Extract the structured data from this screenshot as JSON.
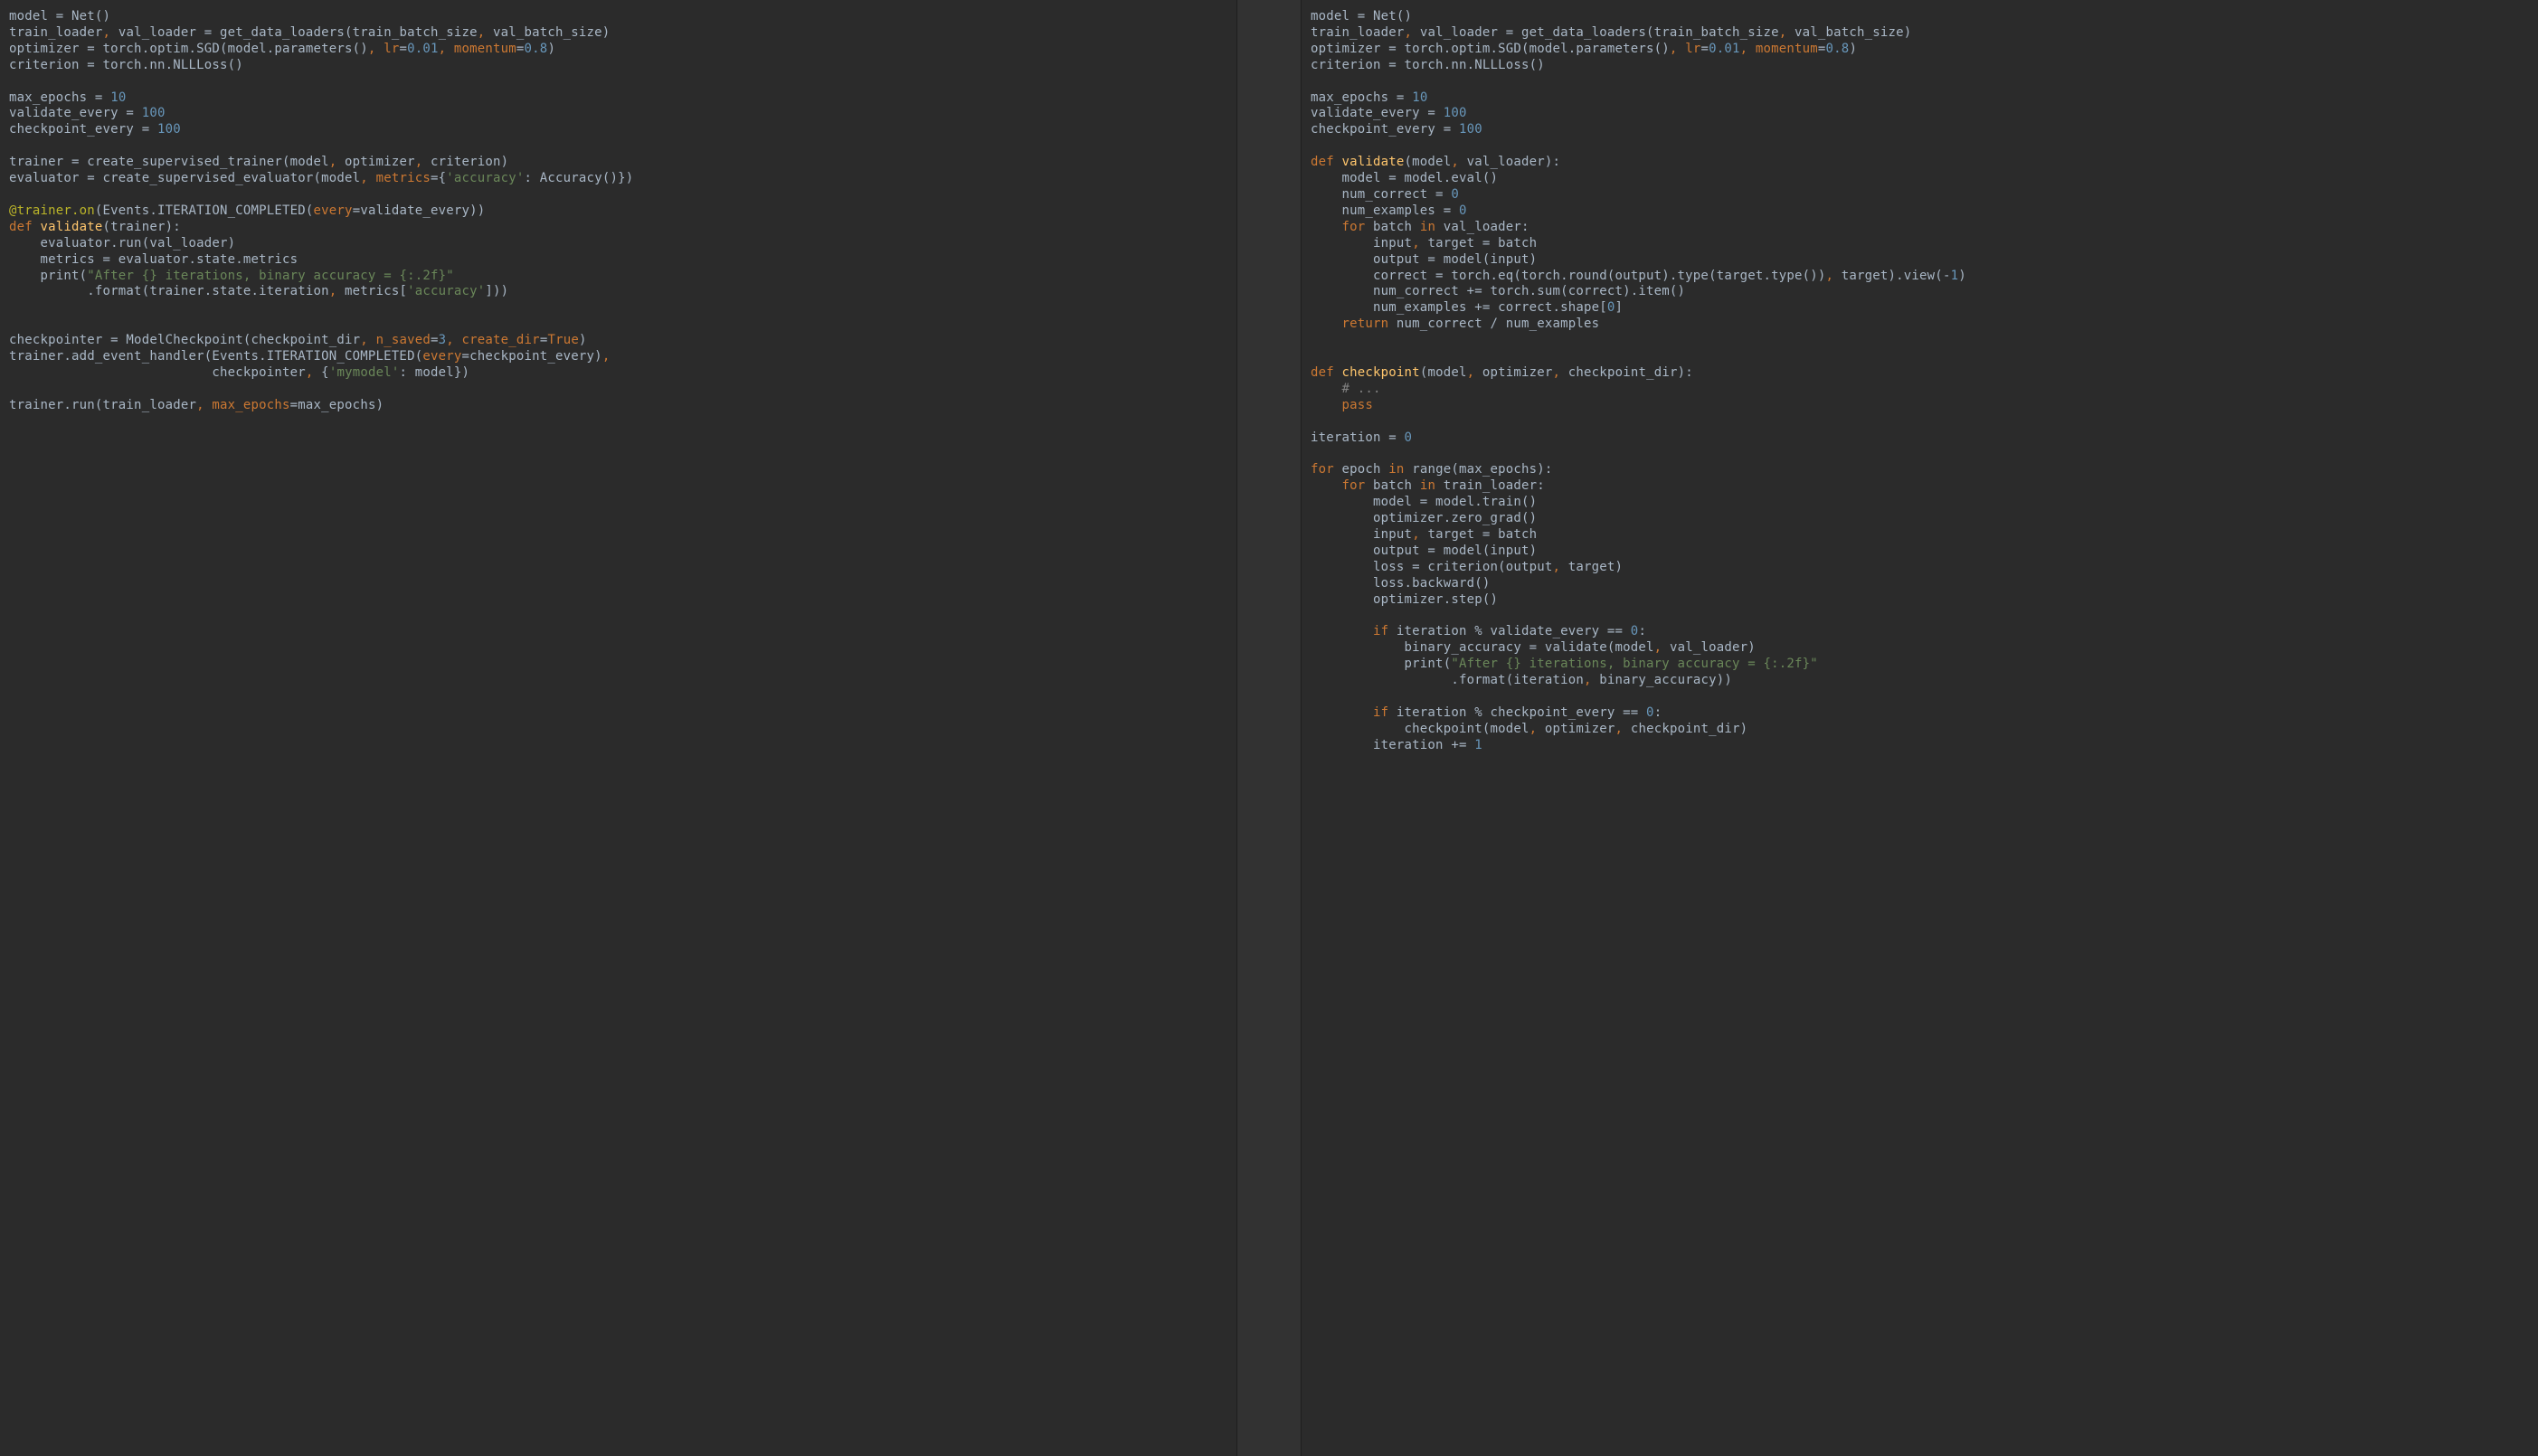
{
  "left": {
    "l1_a": "model = Net()",
    "l2_a": "train_loader",
    "l2_b": ", ",
    "l2_c": "val_loader = get_data_loaders(train_batch_size",
    "l2_d": ", ",
    "l2_e": "val_batch_size)",
    "l3_a": "optimizer = torch.optim.SGD(model.parameters()",
    "l3_b": ", ",
    "l3_c": "lr",
    "l3_d": "=",
    "l3_e": "0.01",
    "l3_f": ", ",
    "l3_g": "momentum",
    "l3_h": "=",
    "l3_i": "0.8",
    "l3_j": ")",
    "l4_a": "criterion = torch.nn.NLLLoss()",
    "l6_a": "max_epochs = ",
    "l6_b": "10",
    "l7_a": "validate_every = ",
    "l7_b": "100",
    "l8_a": "checkpoint_every = ",
    "l8_b": "100",
    "l10_a": "trainer = create_supervised_trainer(model",
    "l10_b": ", ",
    "l10_c": "optimizer",
    "l10_d": ", ",
    "l10_e": "criterion)",
    "l11_a": "evaluator = create_supervised_evaluator(model",
    "l11_b": ", ",
    "l11_c": "metrics",
    "l11_d": "={",
    "l11_e": "'accuracy'",
    "l11_f": ": Accuracy()})",
    "l13_a": "@trainer.on",
    "l13_b": "(Events.ITERATION_COMPLETED(",
    "l13_c": "every",
    "l13_d": "=validate_every))",
    "l14_a": "def ",
    "l14_b": "validate",
    "l14_c": "(trainer):",
    "l15_a": "    evaluator.run(val_loader)",
    "l16_a": "    metrics = evaluator.state.metrics",
    "l17_a": "    print(",
    "l17_b": "\"After {} iterations, binary accuracy = {:.2f}\"",
    "l18_a": "          .format(trainer.state.iteration",
    "l18_b": ", ",
    "l18_c": "metrics[",
    "l18_d": "'accuracy'",
    "l18_e": "]))",
    "l21_a": "checkpointer = ModelCheckpoint(checkpoint_dir",
    "l21_b": ", ",
    "l21_c": "n_saved",
    "l21_d": "=",
    "l21_e": "3",
    "l21_f": ", ",
    "l21_g": "create_dir",
    "l21_h": "=",
    "l21_i": "True",
    "l21_j": ")",
    "l22_a": "trainer.add_event_handler(Events.ITERATION_COMPLETED(",
    "l22_b": "every",
    "l22_c": "=checkpoint_every)",
    "l22_d": ",",
    "l23_a": "                          checkpointer",
    "l23_b": ", ",
    "l23_c": "{",
    "l23_d": "'mymodel'",
    "l23_e": ": model})",
    "l25_a": "trainer.run(train_loader",
    "l25_b": ", ",
    "l25_c": "max_epochs",
    "l25_d": "=max_epochs)"
  },
  "right": {
    "l1_a": "model = Net()",
    "l2_a": "train_loader",
    "l2_b": ", ",
    "l2_c": "val_loader = get_data_loaders(train_batch_size",
    "l2_d": ", ",
    "l2_e": "val_batch_size)",
    "l3_a": "optimizer = torch.optim.SGD(model.parameters()",
    "l3_b": ", ",
    "l3_c": "lr",
    "l3_d": "=",
    "l3_e": "0.01",
    "l3_f": ", ",
    "l3_g": "momentum",
    "l3_h": "=",
    "l3_i": "0.8",
    "l3_j": ")",
    "l4_a": "criterion = torch.nn.NLLLoss()",
    "l6_a": "max_epochs = ",
    "l6_b": "10",
    "l7_a": "validate_every = ",
    "l7_b": "100",
    "l8_a": "checkpoint_every = ",
    "l8_b": "100",
    "l10_a": "def ",
    "l10_b": "validate",
    "l10_c": "(model",
    "l10_d": ", ",
    "l10_e": "val_loader):",
    "l11_a": "    model = model.eval()",
    "l12_a": "    num_correct = ",
    "l12_b": "0",
    "l13_a": "    num_examples = ",
    "l13_b": "0",
    "l14_a": "    ",
    "l14_b": "for ",
    "l14_c": "batch ",
    "l14_d": "in ",
    "l14_e": "val_loader:",
    "l15_a": "        input",
    "l15_b": ", ",
    "l15_c": "target = batch",
    "l16_a": "        output = model(input)",
    "l17_a": "        correct = torch.eq(torch.round(output).type(target.type())",
    "l17_b": ", ",
    "l17_c": "target).view(-",
    "l17_d": "1",
    "l17_e": ")",
    "l18_a": "        num_correct += torch.sum(correct).item()",
    "l19_a": "        num_examples += correct.shape[",
    "l19_b": "0",
    "l19_c": "]",
    "l20_a": "    ",
    "l20_b": "return ",
    "l20_c": "num_correct / num_examples",
    "l23_a": "def ",
    "l23_b": "checkpoint",
    "l23_c": "(model",
    "l23_d": ", ",
    "l23_e": "optimizer",
    "l23_f": ", ",
    "l23_g": "checkpoint_dir):",
    "l24_a": "    ",
    "l24_b": "# ...",
    "l25_a": "    ",
    "l25_b": "pass",
    "l27_a": "iteration = ",
    "l27_b": "0",
    "l29_a": "for ",
    "l29_b": "epoch ",
    "l29_c": "in ",
    "l29_d": "range(max_epochs):",
    "l30_a": "    ",
    "l30_b": "for ",
    "l30_c": "batch ",
    "l30_d": "in ",
    "l30_e": "train_loader:",
    "l31_a": "        model = model.train()",
    "l32_a": "        optimizer.zero_grad()",
    "l33_a": "        input",
    "l33_b": ", ",
    "l33_c": "target = batch",
    "l34_a": "        output = model(input)",
    "l35_a": "        loss = criterion(output",
    "l35_b": ", ",
    "l35_c": "target)",
    "l36_a": "        loss.backward()",
    "l37_a": "        optimizer.step()",
    "l39_a": "        ",
    "l39_b": "if ",
    "l39_c": "iteration % validate_every == ",
    "l39_d": "0",
    "l39_e": ":",
    "l40_a": "            binary_accuracy = validate(model",
    "l40_b": ", ",
    "l40_c": "val_loader)",
    "l41_a": "            print(",
    "l41_b": "\"After {} iterations, binary accuracy = {:.2f}\"",
    "l42_a": "                  .format(iteration",
    "l42_b": ", ",
    "l42_c": "binary_accuracy))",
    "l44_a": "        ",
    "l44_b": "if ",
    "l44_c": "iteration % checkpoint_every == ",
    "l44_d": "0",
    "l44_e": ":",
    "l45_a": "            checkpoint(model",
    "l45_b": ", ",
    "l45_c": "optimizer",
    "l45_d": ", ",
    "l45_e": "checkpoint_dir)",
    "l46_a": "        iteration += ",
    "l46_b": "1"
  }
}
